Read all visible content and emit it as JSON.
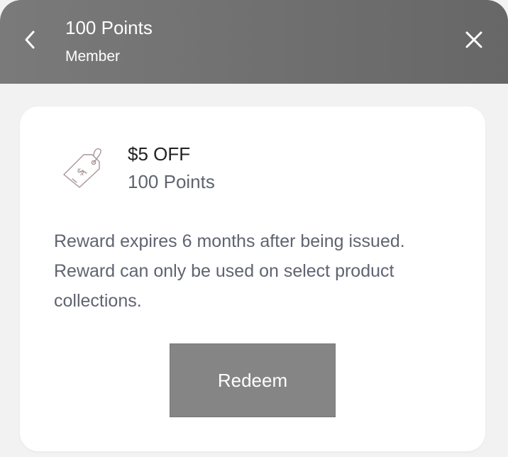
{
  "header": {
    "title": "100 Points",
    "subtitle": "Member",
    "back_icon": "chevron-left-icon",
    "close_icon": "close-icon",
    "background_color": "#6f6f6f"
  },
  "reward": {
    "icon": "price-tag-icon",
    "title": "$5 OFF",
    "cost": "100 Points",
    "description_line_1": "Reward expires 6 months after being issued.",
    "description_line_2": "Reward can only be used on select product collections.",
    "redeem_label": "Redeem",
    "redeem_color": "#858585"
  }
}
